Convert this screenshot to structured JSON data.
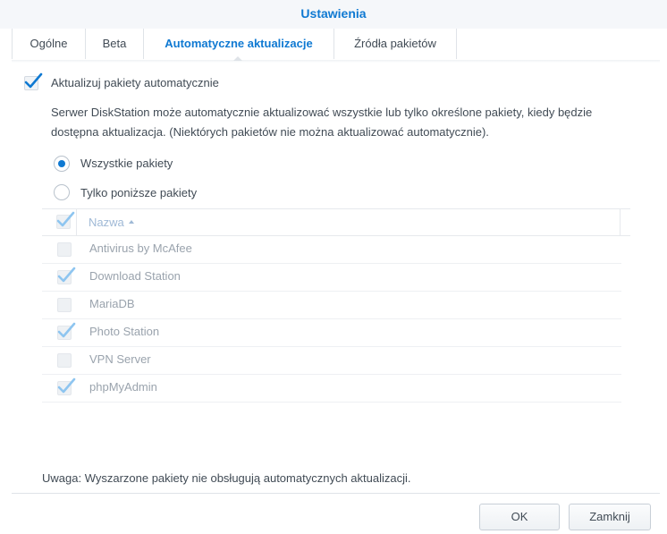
{
  "window": {
    "title": "Ustawienia"
  },
  "tabs": [
    {
      "label": "Ogólne",
      "active": false
    },
    {
      "label": "Beta",
      "active": false
    },
    {
      "label": "Automatyczne aktualizacje",
      "active": true
    },
    {
      "label": "Źródła pakietów",
      "active": false
    }
  ],
  "auto_update": {
    "label": "Aktualizuj pakiety automatycznie",
    "checked": true
  },
  "description": "Serwer DiskStation może automatycznie aktualizować wszystkie lub tylko określone pakiety, kiedy będzie dostępna aktualizacja. (Niektórych pakietów nie można aktualizować automatycznie).",
  "radios": [
    {
      "label": "Wszystkie pakiety",
      "selected": true
    },
    {
      "label": "Tylko poniższe pakiety",
      "selected": false
    }
  ],
  "grid": {
    "header_name": "Nazwa",
    "sort": "ascending",
    "header_checked": true,
    "rows": [
      {
        "name": "Antivirus by McAfee",
        "checked": false
      },
      {
        "name": "Download Station",
        "checked": true
      },
      {
        "name": "MariaDB",
        "checked": false
      },
      {
        "name": "Photo Station",
        "checked": true
      },
      {
        "name": "VPN Server",
        "checked": false
      },
      {
        "name": "phpMyAdmin",
        "checked": true
      }
    ]
  },
  "note": "Uwaga: Wyszarzone pakiety nie obsługują automatycznych aktualizacji.",
  "buttons": {
    "ok": "OK",
    "close": "Zamknij"
  },
  "colors": {
    "accent": "#0f79d2",
    "check_disabled": "#8ec5f0"
  }
}
